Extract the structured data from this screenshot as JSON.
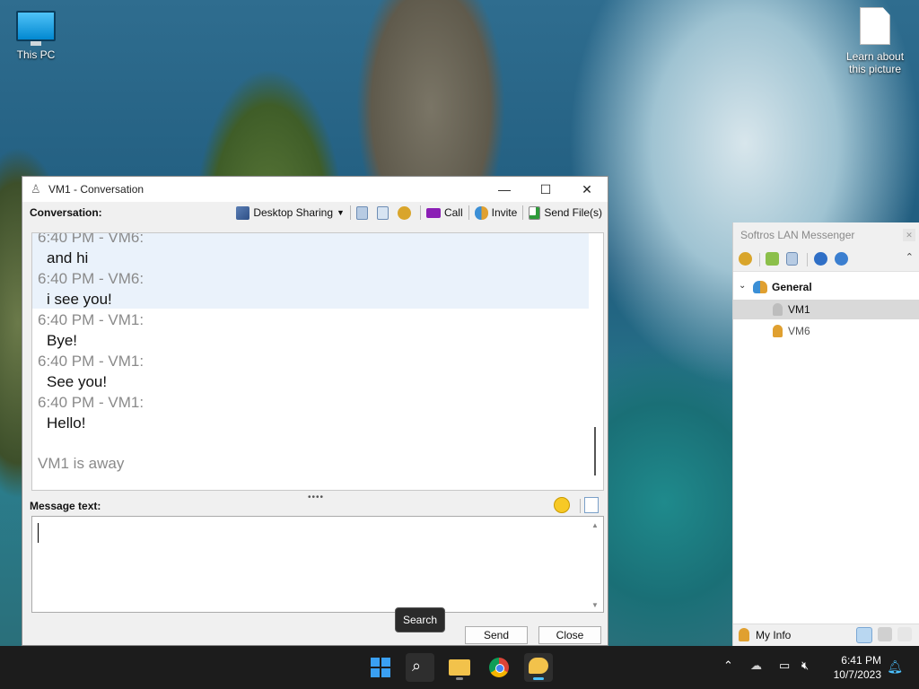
{
  "desktop": {
    "icons": [
      {
        "label": "This PC"
      },
      {
        "label": "Learn about this picture"
      }
    ]
  },
  "conversation": {
    "title": "VM1 - Conversation",
    "controls": {
      "minimize": "—",
      "maximize": "☐",
      "close": "✕"
    },
    "label": "Conversation:",
    "toolbar": {
      "desktop_sharing": "Desktop Sharing",
      "call": "Call",
      "invite": "Invite",
      "send_files": "Send File(s)"
    },
    "messages": [
      {
        "meta": "6:40 PM - VM6:",
        "text": "and hi"
      },
      {
        "meta": "6:40 PM - VM6:",
        "text": "i see you!"
      },
      {
        "meta": "6:40 PM - VM1:",
        "text": "Bye!"
      },
      {
        "meta": "6:40 PM - VM1:",
        "text": "See you!"
      },
      {
        "meta": "6:40 PM - VM1:",
        "text": "Hello!"
      }
    ],
    "status_line": "VM1 is away",
    "message_label": "Message text:",
    "input_value": "",
    "send_label": "Send",
    "close_label": "Close"
  },
  "tooltip": "Search",
  "messenger": {
    "title": "Softros LAN Messenger",
    "group": "General",
    "users": [
      {
        "name": "VM1",
        "selected": true,
        "color": "#bdbdbd"
      },
      {
        "name": "VM6",
        "selected": false,
        "color": "#e0a030"
      }
    ],
    "my_info": "My Info"
  },
  "taskbar": {
    "time": "6:41 PM",
    "date": "10/7/2023"
  },
  "colors": {
    "taskbar": "#1c1c1c",
    "accent": "#4cc2ff",
    "highlight": "#eaf2fb"
  }
}
